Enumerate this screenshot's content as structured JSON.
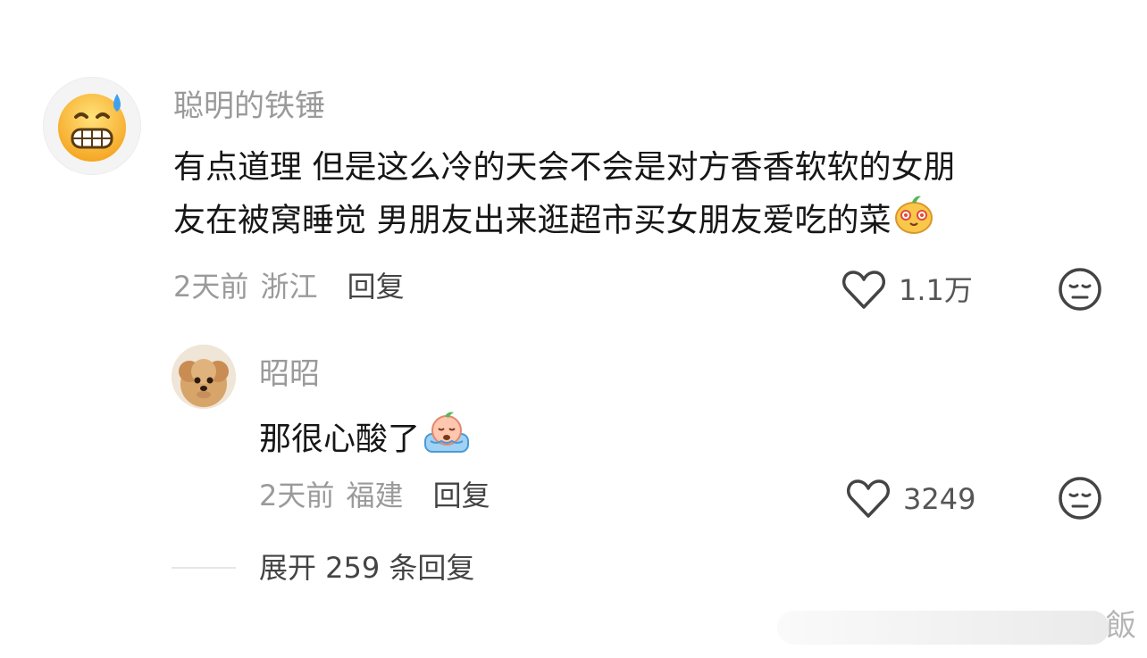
{
  "comments": [
    {
      "username": "聪明的铁锤",
      "text_line1": "有点道理  但是这么冷的天会不会是对方香香软软的女朋",
      "text_line2": "友在被窝睡觉  男朋友出来逛超市买女朋友爱吃的菜",
      "time": "2天前",
      "location": "浙江",
      "reply_label": "回复",
      "likes": "1.1万"
    },
    {
      "username": "昭昭",
      "text": "那很心酸了",
      "time": "2天前",
      "location": "福建",
      "reply_label": "回复",
      "likes": "3249"
    }
  ],
  "expand_label": "展开 259 条回复",
  "watermark": "飯",
  "colors": {
    "muted": "#9a9a9a",
    "text": "#161616",
    "icon": "#444444"
  }
}
